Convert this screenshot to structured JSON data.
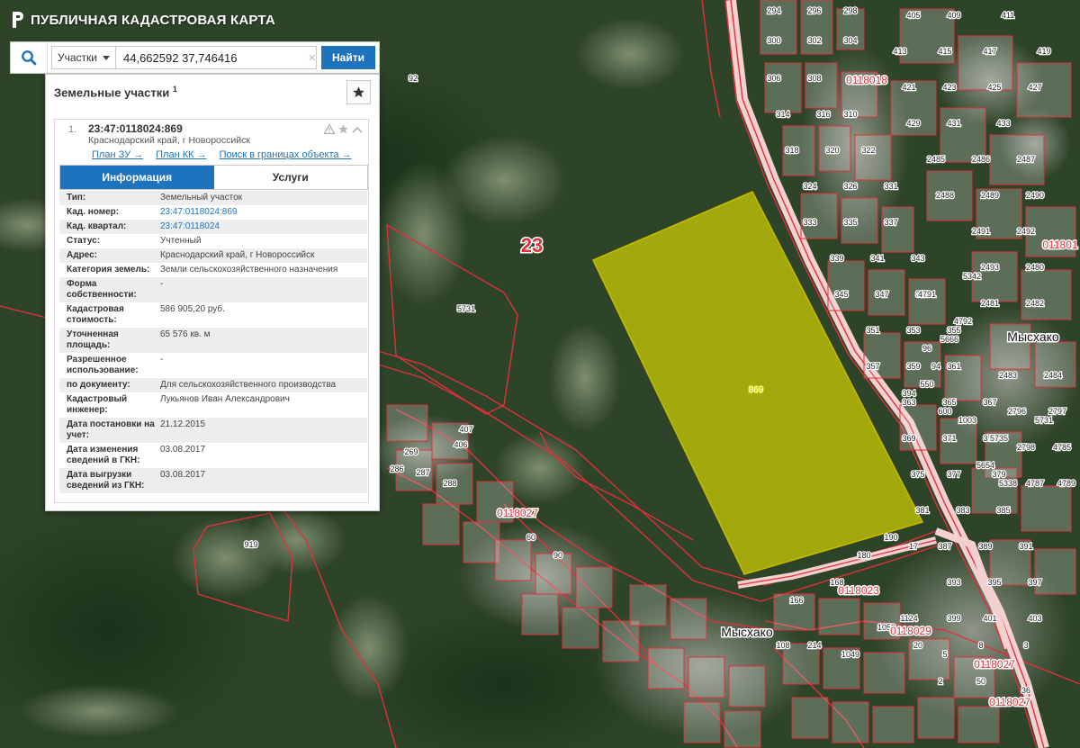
{
  "app": {
    "title": "ПУБЛИЧНАЯ КАДАСТРОВАЯ КАРТА"
  },
  "search": {
    "type_label": "Участки",
    "query": "44,662592 37,746416",
    "button": "Найти"
  },
  "panel": {
    "title": "Земельные участки",
    "count": "1",
    "card": {
      "index": "1.",
      "cad_number": "23:47:0118024:869",
      "address": "Краснодарский край, г Новороссийск",
      "links": [
        "План ЗУ →",
        "План КК →",
        "Поиск в границах объекта →"
      ],
      "tabs": [
        "Информация",
        "Услуги"
      ],
      "rows": [
        {
          "k": "Тип:",
          "v": "Земельный участок"
        },
        {
          "k": "Кад. номер:",
          "v": "23:47:0118024:869",
          "link": true
        },
        {
          "k": "Кад. квартал:",
          "v": "23:47:0118024",
          "link": true
        },
        {
          "k": "Статус:",
          "v": "Учтенный"
        },
        {
          "k": "Адрес:",
          "v": "Краснодарский край, г Новороссийск"
        },
        {
          "k": "Категория земель:",
          "v": "Земли сельскохозяйственного назначения"
        },
        {
          "k": "Форма собственности:",
          "v": "-"
        },
        {
          "k": "Кадастровая стоимость:",
          "v": "586 905,20 руб."
        },
        {
          "k": "Уточненная площадь:",
          "v": "65 576 кв. м"
        },
        {
          "k": "Разрешенное использование:",
          "v": "-"
        },
        {
          "k": "по документу:",
          "v": "Для сельскохозяйственного производства"
        },
        {
          "k": "Кадастровый инженер:",
          "v": "Лукьянов Иван Александрович"
        },
        {
          "k": "Дата постановки на учет:",
          "v": "21.12.2015"
        },
        {
          "k": "Дата изменения сведений в ГКН:",
          "v": "03.08.2017"
        },
        {
          "k": "Дата выгрузки сведений из ГКН:",
          "v": "03.08.2017"
        }
      ]
    }
  },
  "map": {
    "colors": {
      "vegetation": "#2c4028",
      "boundary": "#e0303a",
      "highlight": "#d8d800",
      "road": "#f3c9c9"
    },
    "region_label": "23",
    "parcel_label": "869",
    "quarter_labels": [
      "0118018",
      "0118027",
      "0118023",
      "0118029",
      "0118027",
      "0118027",
      "011801"
    ],
    "place_labels": [
      "Мысхако",
      "Мысхако"
    ],
    "parcel_numbers": [
      "92",
      "5731",
      "919",
      "407",
      "406",
      "269",
      "286",
      "287",
      "288",
      "294",
      "296",
      "298",
      "300",
      "302",
      "304",
      "306",
      "308",
      "310",
      "314",
      "316",
      "318",
      "320",
      "322",
      "324",
      "326",
      "331",
      "333",
      "335",
      "337",
      "339",
      "341",
      "343",
      "345",
      "347",
      "349",
      "351",
      "353",
      "355",
      "357",
      "359",
      "361",
      "363",
      "365",
      "367",
      "369",
      "371",
      "373",
      "375",
      "377",
      "379",
      "381",
      "383",
      "385",
      "387",
      "389",
      "391",
      "393",
      "395",
      "397",
      "399",
      "401",
      "403",
      "405",
      "409",
      "411",
      "413",
      "415",
      "417",
      "419",
      "421",
      "423",
      "425",
      "427",
      "429",
      "431",
      "433",
      "2485",
      "2486",
      "2487",
      "2488",
      "2489",
      "2490",
      "2491",
      "2492",
      "2493",
      "2480",
      "2481",
      "2482",
      "2483",
      "2484",
      "2796",
      "2797",
      "2798",
      "4785",
      "4787",
      "4789",
      "4791",
      "4792",
      "5666",
      "5342",
      "5338",
      "5654",
      "5735",
      "5731",
      "1003",
      "600",
      "550",
      "394",
      "94",
      "96",
      "166",
      "168",
      "180",
      "190",
      "17",
      "108",
      "214",
      "1049",
      "1050",
      "1124",
      "20",
      "5",
      "8",
      "3",
      "2",
      "50",
      "36",
      "60",
      "90"
    ]
  }
}
